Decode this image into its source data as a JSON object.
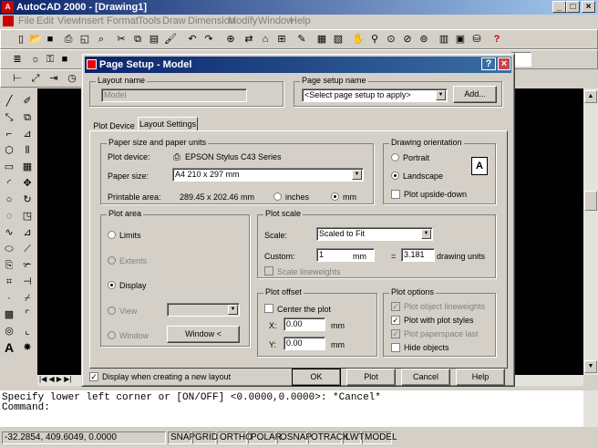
{
  "app": {
    "title": "AutoCAD 2000 - [Drawing1]",
    "menu": [
      "File",
      "Edit",
      "View",
      "Insert",
      "Format",
      "Tools",
      "Draw",
      "Dimension",
      "Modify",
      "Window",
      "Help"
    ]
  },
  "command_line": {
    "lines": [
      "Specify lower left corner or [ON/OFF] <0.0000,0.0000>: *Cancel*",
      "Command:"
    ]
  },
  "status_bar": {
    "coords": "-32.2854, 409.6049, 0.0000",
    "toggles": [
      "SNAP",
      "GRID",
      "ORTHO",
      "POLAR",
      "OSNAP",
      "OTRACK",
      "LWT",
      "MODEL"
    ]
  },
  "dialog": {
    "title": "Page Setup - Model",
    "layout_name": {
      "label": "Layout name",
      "value": "Model"
    },
    "page_setup_name": {
      "label": "Page setup name",
      "value": "<Select page setup to apply>",
      "add_button": "Add..."
    },
    "tabs": [
      "Plot Device",
      "Layout Settings"
    ],
    "paper": {
      "group_label": "Paper size and paper units",
      "plot_device_label": "Plot device:",
      "plot_device_value": "EPSON Stylus C43 Series",
      "paper_size_label": "Paper size:",
      "paper_size_value": "A4 210 x 297 mm",
      "printable_label": "Printable area:",
      "printable_value": "289.45 x 202.46 mm",
      "inches_label": "inches",
      "mm_label": "mm"
    },
    "orientation": {
      "group_label": "Drawing orientation",
      "portrait": "Portrait",
      "landscape": "Landscape",
      "upside_down": "Plot upside-down"
    },
    "plot_area": {
      "group_label": "Plot area",
      "limits": "Limits",
      "extents": "Extents",
      "display": "Display",
      "view": "View",
      "window": "Window",
      "window_button": "Window <"
    },
    "plot_scale": {
      "group_label": "Plot scale",
      "scale_label": "Scale:",
      "scale_value": "Scaled to Fit",
      "custom_label": "Custom:",
      "custom_value": "1",
      "mm_label": "mm",
      "equals": "=",
      "units_value": "3.181",
      "units_label": "drawing units",
      "scale_lineweights": "Scale lineweights"
    },
    "plot_offset": {
      "group_label": "Plot offset",
      "center": "Center the plot",
      "x_label": "X:",
      "x_value": "0.00",
      "y_label": "Y:",
      "y_value": "0.00",
      "mm_label": "mm"
    },
    "plot_options": {
      "group_label": "Plot options",
      "object_lw": "Plot object lineweights",
      "plot_styles": "Plot with plot styles",
      "paperspace_last": "Plot paperspace last",
      "hide": "Hide objects"
    },
    "display_new_layout": "Display when creating a new layout",
    "buttons": {
      "ok": "OK",
      "plot": "Plot",
      "cancel": "Cancel",
      "help": "Help"
    }
  }
}
